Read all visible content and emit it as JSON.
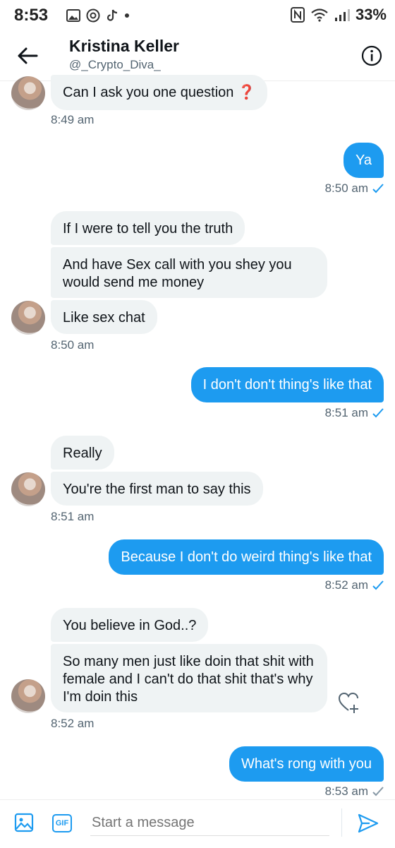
{
  "status_bar": {
    "time": "8:53",
    "battery": "33%"
  },
  "header": {
    "name": "Kristina Keller",
    "handle": "@_Crypto_Diva_"
  },
  "messages": {
    "m1": "Can I ask you one question ❓",
    "t1": "8:49 am",
    "m2": "Ya",
    "t2": "8:50 am",
    "m3": "If I were to tell you the truth",
    "m4": "And have Sex call with you shey you would send me money",
    "m5": "Like sex chat",
    "t3": "8:50 am",
    "m6": "I don't don't thing's like that",
    "t4": "8:51 am",
    "m7": "Really",
    "m8": "You're the first man to say this",
    "t5": "8:51 am",
    "m9": "Because I don't do weird thing's like that",
    "t6": "8:52 am",
    "m10": "You believe in God..?",
    "m11": "So many men just like doin that shit with female and I can't do that shit that's why I'm doin this",
    "t7": "8:52 am",
    "m12": "What's rong with you",
    "t8": "8:53 am"
  },
  "composer": {
    "placeholder": "Start a message",
    "gif_label": "GIF"
  },
  "colors": {
    "accent": "#1d9bf0",
    "incoming_bg": "#eff3f4",
    "secondary_text": "#536471"
  }
}
